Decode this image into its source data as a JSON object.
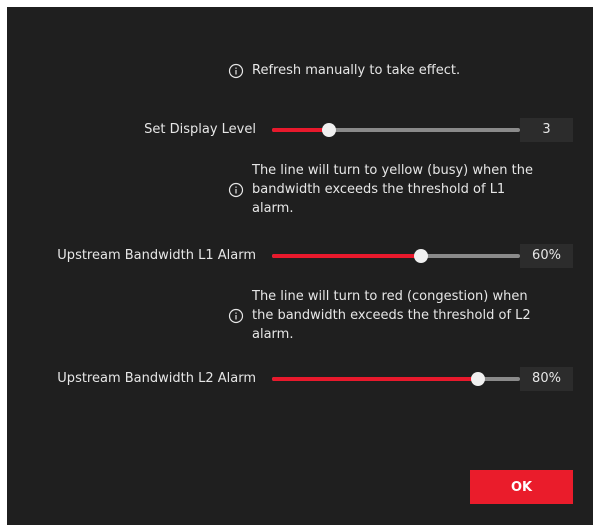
{
  "notes": {
    "refresh": "Refresh manually to take effect.",
    "l1_line1": "The line will turn to yellow (busy) when the",
    "l1_line2": "bandwidth exceeds the threshold of L1",
    "l1_line3": "alarm.",
    "l2_line1": "The line will turn to red (congestion) when",
    "l2_line2": "the bandwidth exceeds the threshold of L2",
    "l2_line3": "alarm."
  },
  "display_level": {
    "label": "Set Display Level",
    "value": "3",
    "fraction": 0.23
  },
  "l1_alarm": {
    "label": "Upstream Bandwidth L1 Alarm",
    "value": "60%",
    "fraction": 0.6
  },
  "l2_alarm": {
    "label": "Upstream Bandwidth L2 Alarm",
    "value": "80%",
    "fraction": 0.83
  },
  "footer": {
    "ok_label": "OK"
  },
  "colors": {
    "background": "#1f1f1f",
    "accent": "#ea1c2b",
    "track": "#8a8a8a",
    "thumb": "#f0f0f0",
    "value_box": "#2c2c2c",
    "text": "#e6e6e6"
  },
  "icons": {
    "info": "info-circle-icon"
  }
}
